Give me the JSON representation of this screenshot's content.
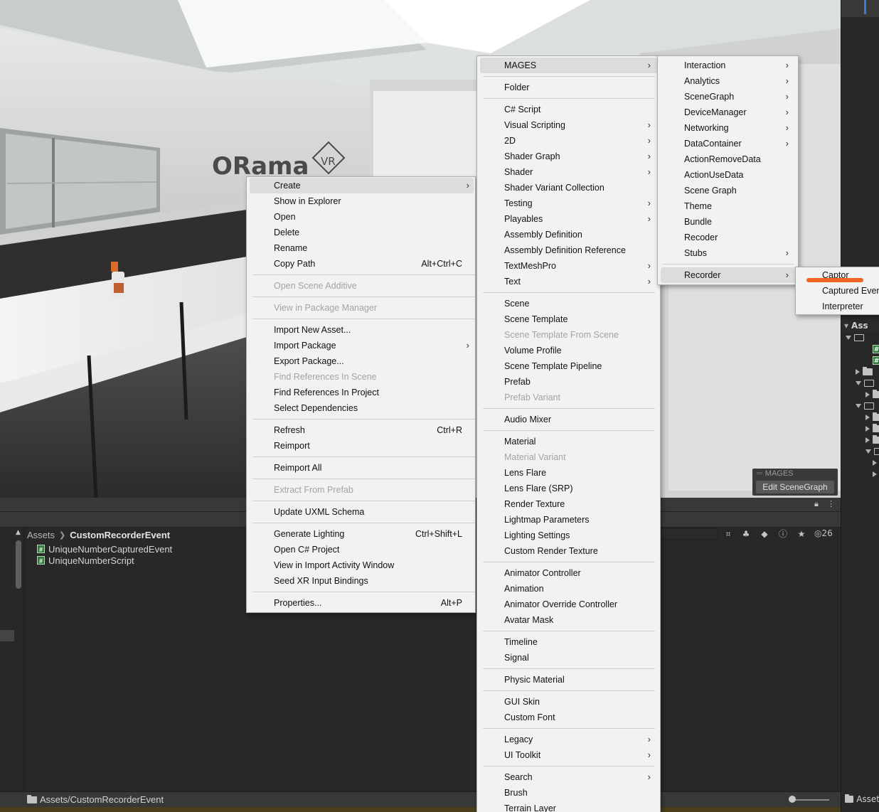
{
  "scene": {
    "logo_text": "ORama",
    "logo_badge": "VR",
    "overlay_title": "MAGES",
    "overlay_button": "Edit SceneGraph"
  },
  "project": {
    "breadcrumb_root": "Assets",
    "breadcrumb_current": "CustomRecorderEvent",
    "files": [
      "UniqueNumberCapturedEvent",
      "UniqueNumberScript"
    ],
    "path": "Assets/CustomRecorderEvent",
    "hidden_count": "26"
  },
  "right_panel": {
    "assets_header": "Ass",
    "bottom_label": "Asset"
  },
  "menu_main": [
    {
      "label": "Create",
      "arrow": true,
      "highlighted": true
    },
    {
      "label": "Show in Explorer"
    },
    {
      "label": "Open"
    },
    {
      "label": "Delete"
    },
    {
      "label": "Rename"
    },
    {
      "label": "Copy Path",
      "shortcut": "Alt+Ctrl+C"
    },
    {
      "sep": true
    },
    {
      "label": "Open Scene Additive",
      "disabled": true
    },
    {
      "sep": true
    },
    {
      "label": "View in Package Manager",
      "disabled": true
    },
    {
      "sep": true
    },
    {
      "label": "Import New Asset..."
    },
    {
      "label": "Import Package",
      "arrow": true
    },
    {
      "label": "Export Package..."
    },
    {
      "label": "Find References In Scene",
      "disabled": true
    },
    {
      "label": "Find References In Project"
    },
    {
      "label": "Select Dependencies"
    },
    {
      "sep": true
    },
    {
      "label": "Refresh",
      "shortcut": "Ctrl+R"
    },
    {
      "label": "Reimport"
    },
    {
      "sep": true
    },
    {
      "label": "Reimport All"
    },
    {
      "sep": true
    },
    {
      "label": "Extract From Prefab",
      "disabled": true
    },
    {
      "sep": true
    },
    {
      "label": "Update UXML Schema"
    },
    {
      "sep": true
    },
    {
      "label": "Generate Lighting",
      "shortcut": "Ctrl+Shift+L"
    },
    {
      "label": "Open C# Project"
    },
    {
      "label": "View in Import Activity Window"
    },
    {
      "label": "Seed XR Input Bindings"
    },
    {
      "sep": true
    },
    {
      "label": "Properties...",
      "shortcut": "Alt+P"
    }
  ],
  "menu_create": [
    {
      "label": "MAGES",
      "arrow": true,
      "highlighted": true
    },
    {
      "sep": true
    },
    {
      "label": "Folder"
    },
    {
      "sep": true
    },
    {
      "label": "C# Script"
    },
    {
      "label": "Visual Scripting",
      "arrow": true
    },
    {
      "label": "2D",
      "arrow": true
    },
    {
      "label": "Shader Graph",
      "arrow": true
    },
    {
      "label": "Shader",
      "arrow": true
    },
    {
      "label": "Shader Variant Collection"
    },
    {
      "label": "Testing",
      "arrow": true
    },
    {
      "label": "Playables",
      "arrow": true
    },
    {
      "label": "Assembly Definition"
    },
    {
      "label": "Assembly Definition Reference"
    },
    {
      "label": "TextMeshPro",
      "arrow": true
    },
    {
      "label": "Text",
      "arrow": true
    },
    {
      "sep": true
    },
    {
      "label": "Scene"
    },
    {
      "label": "Scene Template"
    },
    {
      "label": "Scene Template From Scene",
      "disabled": true
    },
    {
      "label": "Volume Profile"
    },
    {
      "label": "Scene Template Pipeline"
    },
    {
      "label": "Prefab"
    },
    {
      "label": "Prefab Variant",
      "disabled": true
    },
    {
      "sep": true
    },
    {
      "label": "Audio Mixer"
    },
    {
      "sep": true
    },
    {
      "label": "Material"
    },
    {
      "label": "Material Variant",
      "disabled": true
    },
    {
      "label": "Lens Flare"
    },
    {
      "label": "Lens Flare (SRP)"
    },
    {
      "label": "Render Texture"
    },
    {
      "label": "Lightmap Parameters"
    },
    {
      "label": "Lighting Settings"
    },
    {
      "label": "Custom Render Texture"
    },
    {
      "sep": true
    },
    {
      "label": "Animator Controller"
    },
    {
      "label": "Animation"
    },
    {
      "label": "Animator Override Controller"
    },
    {
      "label": "Avatar Mask"
    },
    {
      "sep": true
    },
    {
      "label": "Timeline"
    },
    {
      "label": "Signal"
    },
    {
      "sep": true
    },
    {
      "label": "Physic Material"
    },
    {
      "sep": true
    },
    {
      "label": "GUI Skin"
    },
    {
      "label": "Custom Font"
    },
    {
      "sep": true
    },
    {
      "label": "Legacy",
      "arrow": true
    },
    {
      "label": "UI Toolkit",
      "arrow": true
    },
    {
      "sep": true
    },
    {
      "label": "Search",
      "arrow": true
    },
    {
      "label": "Brush"
    },
    {
      "label": "Terrain Layer"
    }
  ],
  "menu_mages": [
    {
      "label": "Interaction",
      "arrow": true
    },
    {
      "label": "Analytics",
      "arrow": true
    },
    {
      "label": "SceneGraph",
      "arrow": true
    },
    {
      "label": "DeviceManager",
      "arrow": true
    },
    {
      "label": "Networking",
      "arrow": true
    },
    {
      "label": "DataContainer",
      "arrow": true
    },
    {
      "label": "ActionRemoveData"
    },
    {
      "label": "ActionUseData"
    },
    {
      "label": "Scene Graph"
    },
    {
      "label": "Theme"
    },
    {
      "label": "Bundle"
    },
    {
      "label": "Recoder"
    },
    {
      "label": "Stubs",
      "arrow": true
    },
    {
      "sep": true
    },
    {
      "label": "Recorder",
      "arrow": true,
      "highlighted": true
    }
  ],
  "menu_recorder": [
    {
      "label": "Captor"
    },
    {
      "label": "Captured Event"
    },
    {
      "label": "Interpreter"
    }
  ],
  "colors": {
    "menu_bg": "#f2f2f2",
    "highlight": "#dcdcdc",
    "annotation": "#f06424",
    "editor_bg": "#282828"
  }
}
